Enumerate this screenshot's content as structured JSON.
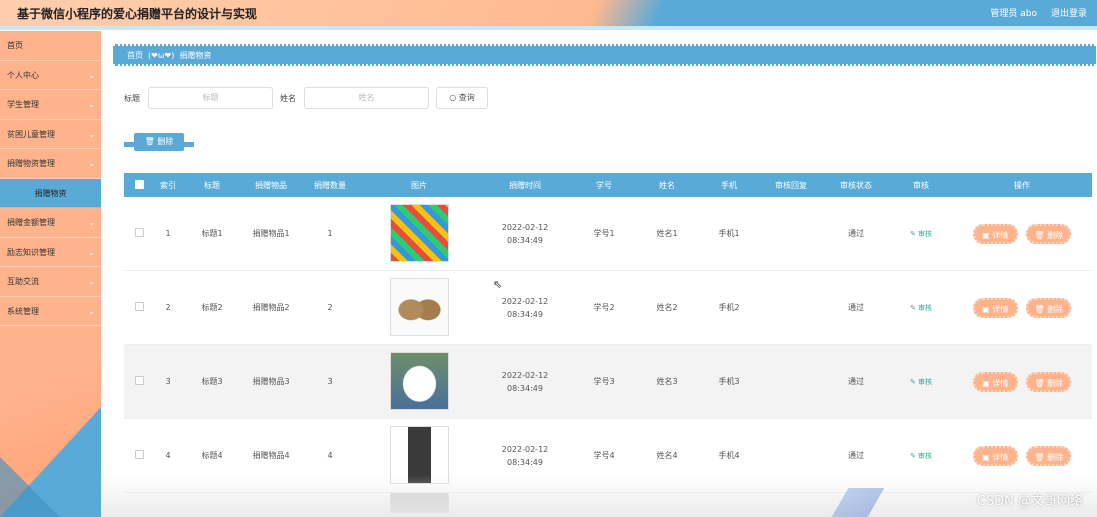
{
  "header": {
    "title": "基于微信小程序的爱心捐赠平台的设计与实现",
    "user": "管理员 abo",
    "logout": "退出登录"
  },
  "sidebar": {
    "items": [
      {
        "label": "首页",
        "chevron": false
      },
      {
        "label": "个人中心",
        "chevron": true
      },
      {
        "label": "学生管理",
        "chevron": true
      },
      {
        "label": "贫困儿童管理",
        "chevron": true
      },
      {
        "label": "捐赠物资管理",
        "chevron": true
      },
      {
        "label": "捐赠物资",
        "chevron": false,
        "sub": true
      },
      {
        "label": "捐赠金额管理",
        "chevron": true
      },
      {
        "label": "励志知识管理",
        "chevron": true
      },
      {
        "label": "互助交流",
        "chevron": true
      },
      {
        "label": "系统管理",
        "chevron": true
      }
    ],
    "chevron_glyph": "⌄"
  },
  "breadcrumb": {
    "home": "首页",
    "hearts": "(❤ω❤)",
    "current": "捐赠物资"
  },
  "search": {
    "title_label": "标题",
    "title_placeholder": "标题",
    "name_label": "姓名",
    "name_placeholder": "姓名",
    "query_button": "查询",
    "query_icon": "search-icon"
  },
  "toolbar": {
    "delete_label": "删除",
    "delete_icon": "trash-icon"
  },
  "table": {
    "columns": [
      "",
      "索引",
      "标题",
      "捐赠物品",
      "捐赠数量",
      "图片",
      "捐赠时间",
      "学号",
      "姓名",
      "手机",
      "审核回复",
      "审核状态",
      "审核",
      "操作"
    ],
    "rows": [
      {
        "index": "1",
        "title": "标题1",
        "item": "捐赠物品1",
        "qty": "1",
        "date": "2022-02-12",
        "time": "08:34:49",
        "sid": "学号1",
        "name": "姓名1",
        "phone": "手机1",
        "reply": "",
        "status": "通过",
        "audit": "审核"
      },
      {
        "index": "2",
        "title": "标题2",
        "item": "捐赠物品2",
        "qty": "2",
        "date": "2022-02-12",
        "time": "08:34:49",
        "sid": "学号2",
        "name": "姓名2",
        "phone": "手机2",
        "reply": "",
        "status": "通过",
        "audit": "审核"
      },
      {
        "index": "3",
        "title": "标题3",
        "item": "捐赠物品3",
        "qty": "3",
        "date": "2022-02-12",
        "time": "08:34:49",
        "sid": "学号3",
        "name": "姓名3",
        "phone": "手机3",
        "reply": "",
        "status": "通过",
        "audit": "审核"
      },
      {
        "index": "4",
        "title": "标题4",
        "item": "捐赠物品4",
        "qty": "4",
        "date": "2022-02-12",
        "time": "08:34:49",
        "sid": "学号4",
        "name": "姓名4",
        "phone": "手机4",
        "reply": "",
        "status": "通过",
        "audit": "审核"
      }
    ],
    "detail_label": "详情",
    "delete_label": "删除"
  },
  "watermark": "CSDN @文哥网络",
  "colors": {
    "header_orange": "#ffb98f",
    "accent_blue": "#5aaad7",
    "button_orange": "#ffb38c",
    "audit_green": "#33aa99"
  }
}
